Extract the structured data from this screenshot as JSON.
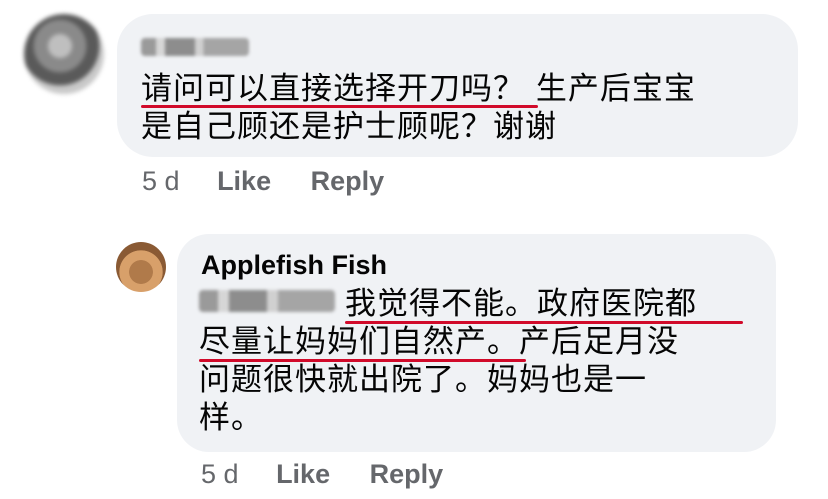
{
  "comment1": {
    "avatar": "blurred-profile-photo",
    "author_obscured": true,
    "text_line1": "请问可以直接选择开刀吗？ 生产后宝宝",
    "text_line2": "是自己顾还是护士顾呢？谢谢",
    "time": "5 d",
    "like_label": "Like",
    "reply_label": "Reply"
  },
  "reply1": {
    "avatar": "toy-elephant-photo",
    "author": "Applefish Fish",
    "mention_obscured": true,
    "text_line1": "我觉得不能。政府医院都",
    "text_line2": "尽量让妈妈们自然产。产后足月没",
    "text_line3": "问题很快就出院了。妈妈也是一",
    "text_line4": "样。",
    "time": "5 d",
    "like_label": "Like",
    "reply_label": "Reply"
  },
  "colors": {
    "bubble": "#f0f2f5",
    "text": "#050505",
    "meta": "#65676b",
    "underline": "#d10a2a"
  }
}
